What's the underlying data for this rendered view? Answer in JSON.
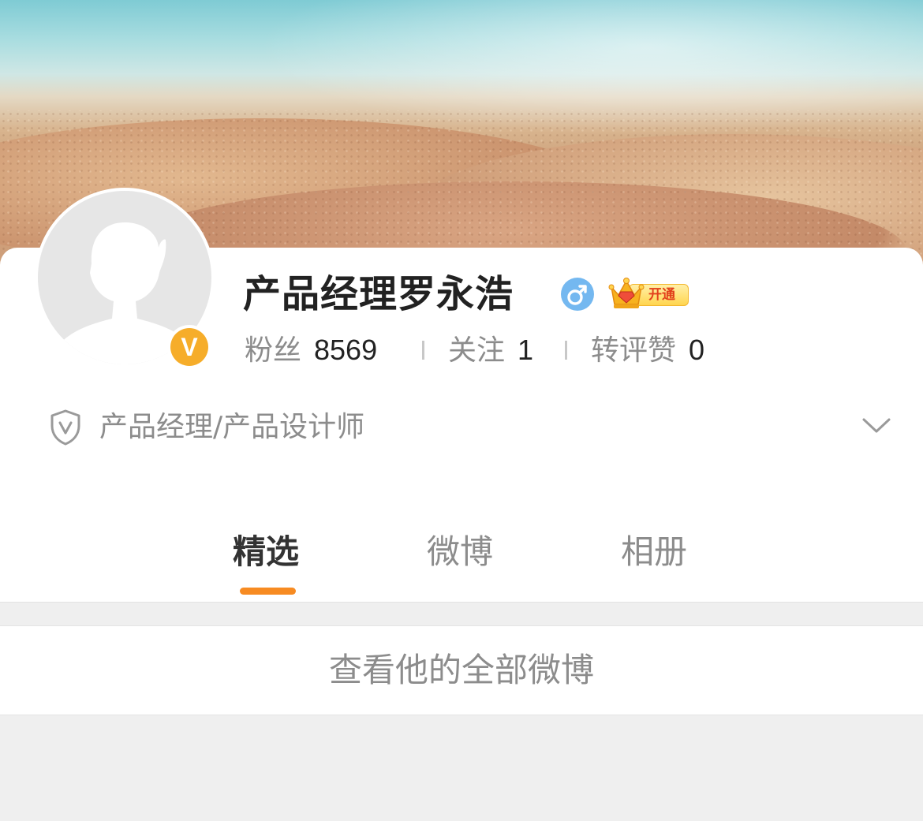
{
  "profile": {
    "name": "产品经理罗永浩",
    "gender": "male",
    "gender_icon": "male-icon",
    "verified_badge": "V",
    "vip_label": "开通",
    "stats": [
      {
        "label": "粉丝",
        "value": "8569"
      },
      {
        "label": "关注",
        "value": "1"
      },
      {
        "label": "转评赞",
        "value": "0"
      }
    ],
    "description": "产品经理/产品设计师"
  },
  "tabs": [
    {
      "label": "精选",
      "active": true
    },
    {
      "label": "微博",
      "active": false
    },
    {
      "label": "相册",
      "active": false
    }
  ],
  "all_posts_label": "查看他的全部微博",
  "colors": {
    "accent": "#f78b22",
    "verified": "#f6ad2a",
    "gender_male": "#74b8f0",
    "text_primary": "#222222",
    "text_secondary": "#8c8c8c",
    "page_bg": "#efefef"
  }
}
